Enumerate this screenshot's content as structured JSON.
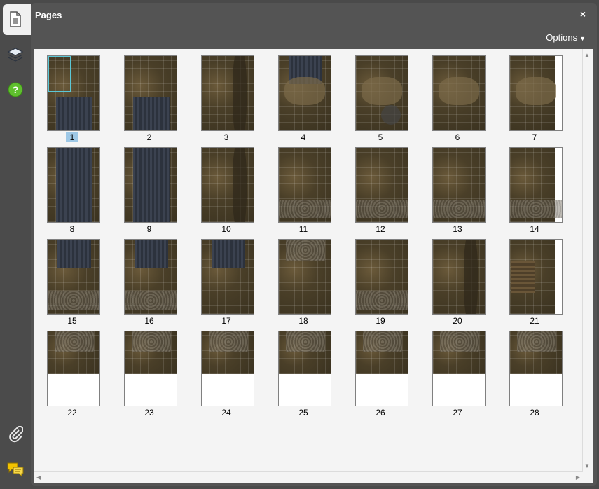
{
  "panel": {
    "title": "Pages",
    "close_label": "×",
    "options_label": "Options"
  },
  "rail": {
    "icons": [
      "pages-icon",
      "layers-icon",
      "help-icon",
      "attachment-icon",
      "comments-icon"
    ]
  },
  "pages": [
    {
      "num": "1",
      "selected": true
    },
    {
      "num": "2"
    },
    {
      "num": "3"
    },
    {
      "num": "4"
    },
    {
      "num": "5"
    },
    {
      "num": "6"
    },
    {
      "num": "7"
    },
    {
      "num": "8"
    },
    {
      "num": "9"
    },
    {
      "num": "10"
    },
    {
      "num": "11"
    },
    {
      "num": "12"
    },
    {
      "num": "13"
    },
    {
      "num": "14"
    },
    {
      "num": "15"
    },
    {
      "num": "16"
    },
    {
      "num": "17"
    },
    {
      "num": "18"
    },
    {
      "num": "19"
    },
    {
      "num": "20"
    },
    {
      "num": "21"
    },
    {
      "num": "22"
    },
    {
      "num": "23"
    },
    {
      "num": "24"
    },
    {
      "num": "25"
    },
    {
      "num": "26"
    },
    {
      "num": "27"
    },
    {
      "num": "28"
    }
  ],
  "colors": {
    "accent": "#5bc7d6",
    "selected_label": "#9ec8e6",
    "panel": "#545454"
  }
}
